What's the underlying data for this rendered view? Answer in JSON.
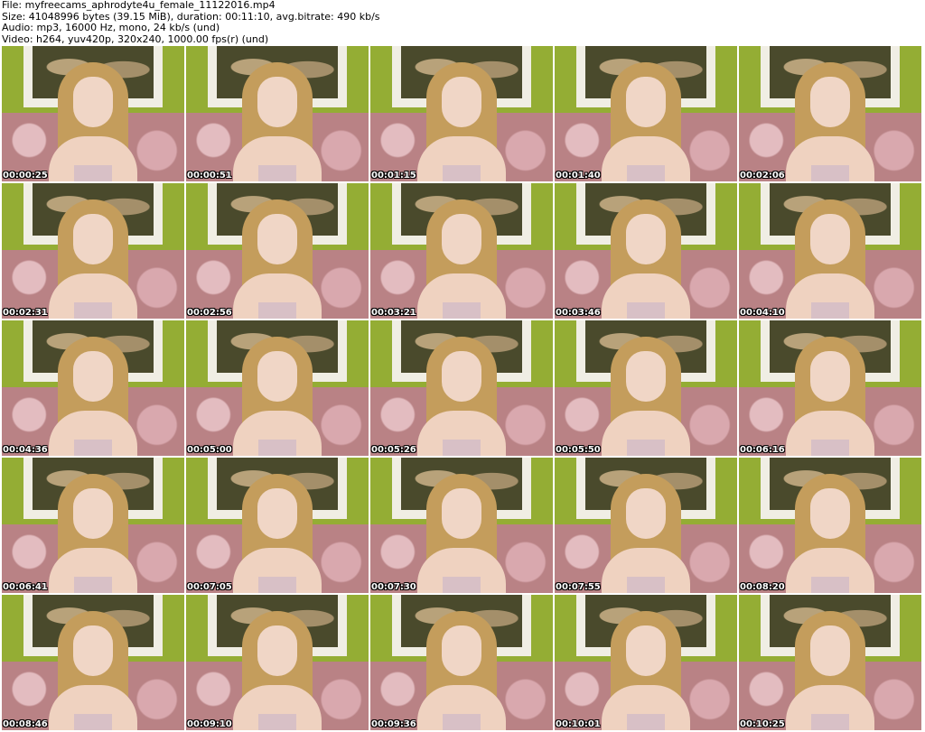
{
  "header": {
    "file": "File: myfreecams_aphrodyte4u_female_11122016.mp4",
    "size": "Size: 41048996 bytes (39.15 MiB), duration: 00:11:10, avg.bitrate: 490 kb/s",
    "audio": "Audio: mp3, 16000 Hz, mono, 24 kb/s (und)",
    "video": "Video: h264, yuv420p, 320x240, 1000.00 fps(r) (und)"
  },
  "thumbnails": [
    {
      "timestamp": "00:00:25"
    },
    {
      "timestamp": "00:00:51"
    },
    {
      "timestamp": "00:01:15"
    },
    {
      "timestamp": "00:01:40"
    },
    {
      "timestamp": "00:02:06"
    },
    {
      "timestamp": "00:02:31"
    },
    {
      "timestamp": "00:02:56"
    },
    {
      "timestamp": "00:03:21"
    },
    {
      "timestamp": "00:03:46"
    },
    {
      "timestamp": "00:04:10"
    },
    {
      "timestamp": "00:04:36"
    },
    {
      "timestamp": "00:05:00"
    },
    {
      "timestamp": "00:05:26"
    },
    {
      "timestamp": "00:05:50"
    },
    {
      "timestamp": "00:06:16"
    },
    {
      "timestamp": "00:06:41"
    },
    {
      "timestamp": "00:07:05"
    },
    {
      "timestamp": "00:07:30"
    },
    {
      "timestamp": "00:07:55"
    },
    {
      "timestamp": "00:08:20"
    },
    {
      "timestamp": "00:08:46"
    },
    {
      "timestamp": "00:09:10"
    },
    {
      "timestamp": "00:09:36"
    },
    {
      "timestamp": "00:10:01"
    },
    {
      "timestamp": "00:10:25"
    }
  ]
}
